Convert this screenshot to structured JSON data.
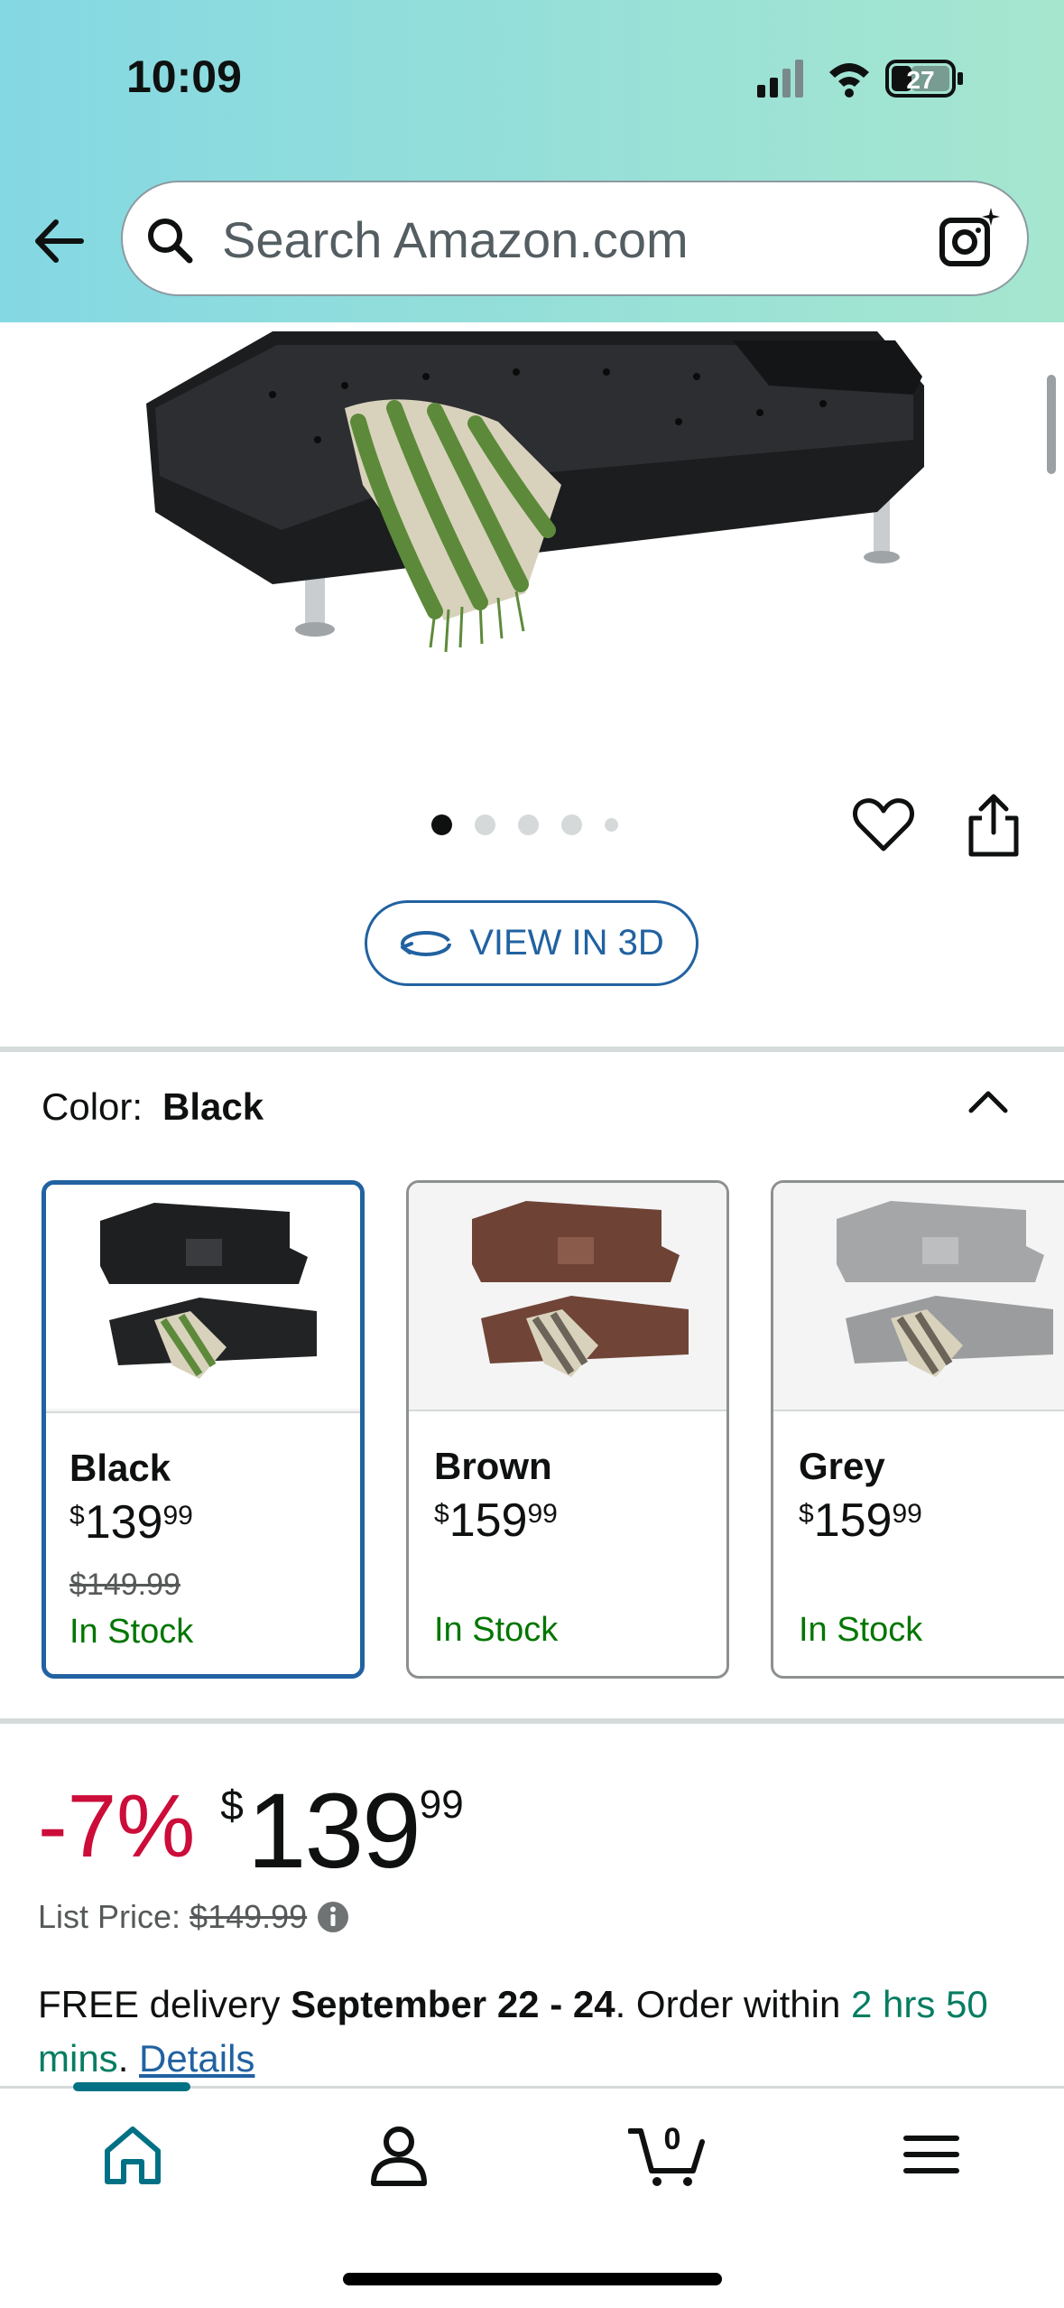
{
  "status_bar": {
    "time": "10:09",
    "battery": "27"
  },
  "search": {
    "placeholder": "Search Amazon.com"
  },
  "gallery": {
    "image_count": 5,
    "active_index": 0
  },
  "view_3d": {
    "label": "VIEW IN 3D"
  },
  "color": {
    "label": "Color:",
    "selected": "Black",
    "options": [
      {
        "name": "Black",
        "price_symbol": "$",
        "price_whole": "139",
        "price_cents": "99",
        "old_price": "$149.99",
        "stock": "In Stock"
      },
      {
        "name": "Brown",
        "price_symbol": "$",
        "price_whole": "159",
        "price_cents": "99",
        "old_price": "",
        "stock": "In Stock"
      },
      {
        "name": "Grey",
        "price_symbol": "$",
        "price_whole": "159",
        "price_cents": "99",
        "old_price": "",
        "stock": "In Stock"
      }
    ]
  },
  "price": {
    "discount": "-7%",
    "symbol": "$",
    "whole": "139",
    "cents": "99",
    "list_label": "List Price:",
    "list_value": "$149.99"
  },
  "delivery": {
    "prefix": "FREE delivery ",
    "dates": "September 22 - 24",
    "middle": ". Order within ",
    "countdown": "2 hrs 50 mins",
    "suffix": ". ",
    "details_link": "Details"
  },
  "nav": {
    "cart_count": "0"
  },
  "colors": {
    "accent_blue": "#2162a1",
    "deal_red": "#cc0c39",
    "stock_green": "#007600",
    "teal": "#007185"
  }
}
